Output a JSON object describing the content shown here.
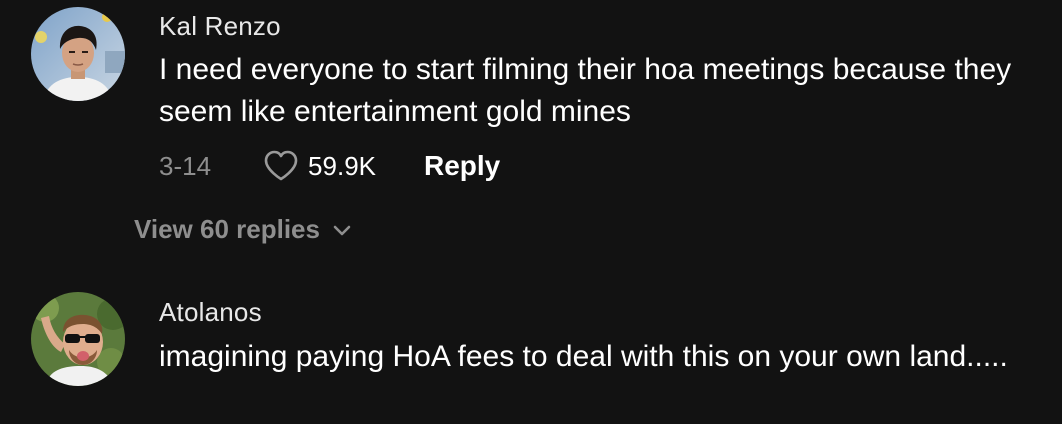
{
  "comments": [
    {
      "username": "Kal Renzo",
      "text": "I need everyone to start filming their hoa meetings because they seem like entertainment gold mines",
      "date": "3-14",
      "likes": "59.9K",
      "reply_label": "Reply",
      "view_replies": "View 60 replies"
    },
    {
      "username": "Atolanos",
      "text": "imagining paying HoA fees to deal with this on your own land....."
    }
  ],
  "icons": {
    "like": "heart-outline-icon",
    "expand": "chevron-down-icon"
  },
  "colors": {
    "background": "#121212",
    "primary_text": "#ffffff",
    "secondary_text": "#8e8e8e"
  }
}
